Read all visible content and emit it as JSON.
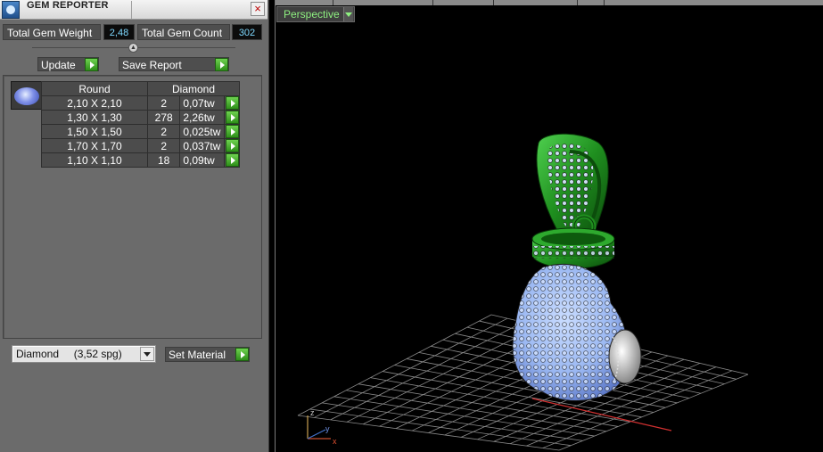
{
  "window": {
    "title": "GEM REPORTER"
  },
  "totals": {
    "weight_label": "Total Gem Weight",
    "weight_value": "2,48",
    "count_label": "Total Gem Count",
    "count_value": "302"
  },
  "actions": {
    "update_label": "Update",
    "save_label": "Save Report"
  },
  "gem_table": {
    "headers": [
      "Round",
      "Diamond"
    ],
    "rows": [
      {
        "size": "2,10 X 2,10",
        "count": "2",
        "weight": "0,07tw"
      },
      {
        "size": "1,30 X 1,30",
        "count": "278",
        "weight": "2,26tw"
      },
      {
        "size": "1,50 X 1,50",
        "count": "2",
        "weight": "0,025tw"
      },
      {
        "size": "1,70 X 1,70",
        "count": "2",
        "weight": "0,037tw"
      },
      {
        "size": "1,10 X 1,10",
        "count": "18",
        "weight": "0,09tw"
      }
    ]
  },
  "material": {
    "selected": "Diamond     (3,52 spg)",
    "set_label": "Set Material"
  },
  "viewport": {
    "view_name": "Perspective",
    "axis_x": "x",
    "axis_y": "y",
    "axis_z": "z"
  },
  "colors": {
    "metal": "#1f8f1f",
    "gem": "#a8c4ff",
    "label_green": "#8ef080",
    "grid": "#8a8a8a"
  },
  "icons": [
    "app-icon",
    "close-icon",
    "arrow-right-icon",
    "chevron-down-icon",
    "splitter-icon",
    "gem-thumbnail-icon"
  ]
}
